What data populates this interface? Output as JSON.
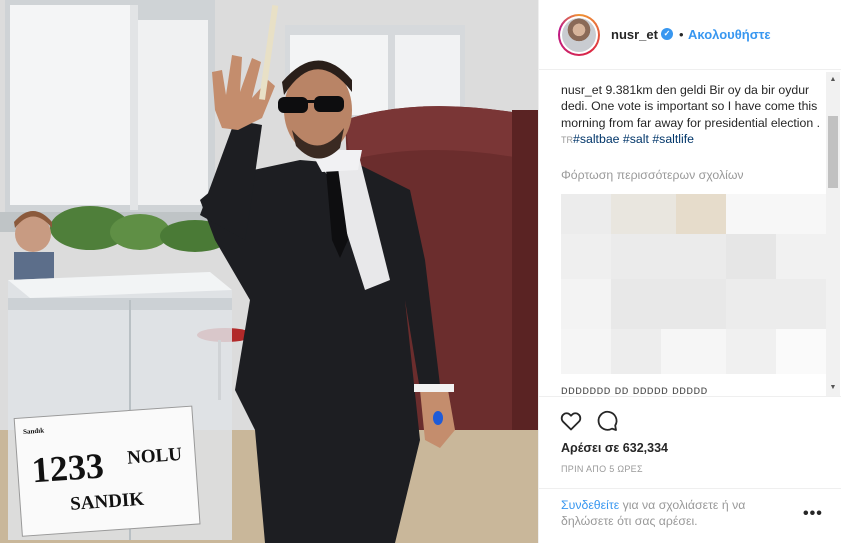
{
  "post": {
    "username": "nusr_et",
    "follow_label": "Ακολουθήστε",
    "separator": "•",
    "caption_user": "nusr_et",
    "caption_text": " 9.381km den geldi Bir oy da bir oydur dedi. One vote is important so I have come this morning from far away for presidential election . ",
    "caption_tr": "TR",
    "hashtag_1": "#saltbae",
    "hashtag_2": "#salt",
    "hashtag_3": "#saltlife",
    "load_more": "Φόρτωση περισσότερων σχολίων",
    "cut_comment": "ᴅᴅᴅᴅᴅᴅᴅ ᴅᴅ ᴅᴅᴅᴅᴅ ᴅᴅᴅᴅᴅ",
    "likes": "Αρέσει σε 632,334",
    "time": "ΠΡΙΝ ΑΠΟ 5 ΩΡΕΣ",
    "login_link": "Συνδεθείτε",
    "login_rest": " για να σχολιάσετε ή να δηλώσετε ότι σας αρέσει.",
    "more_icon": "•••"
  },
  "photo": {
    "sign_number": "1233",
    "sign_nolu": "NOLU",
    "sign_sandik": "SANDIK",
    "sign_small": "Sandık"
  },
  "colors": {
    "accent": "#3897f0",
    "text": "#262626",
    "muted": "#999999"
  }
}
